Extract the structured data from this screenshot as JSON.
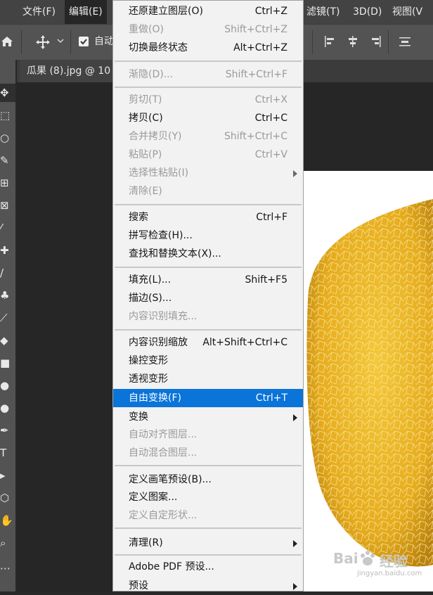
{
  "menubar": {
    "items": [
      {
        "label": "文件(F)"
      },
      {
        "label": "编辑(E)"
      },
      {
        "label": "滤镜(T)"
      },
      {
        "label": "3D(D)"
      },
      {
        "label": "视图(V"
      }
    ]
  },
  "options_bar": {
    "auto_select_label": "自动"
  },
  "tab": {
    "title": "瓜果 (8).jpg @ 10"
  },
  "edit_menu": {
    "items": [
      {
        "label": "还原建立图层(O)",
        "shortcut": "Ctrl+Z",
        "disabled": false
      },
      {
        "label": "重做(O)",
        "shortcut": "Shift+Ctrl+Z",
        "disabled": true
      },
      {
        "label": "切换最终状态",
        "shortcut": "Alt+Ctrl+Z",
        "disabled": false
      },
      {
        "label": "渐隐(D)...",
        "shortcut": "Shift+Ctrl+F",
        "disabled": true
      },
      {
        "label": "剪切(T)",
        "shortcut": "Ctrl+X",
        "disabled": true
      },
      {
        "label": "拷贝(C)",
        "shortcut": "Ctrl+C",
        "disabled": false
      },
      {
        "label": "合并拷贝(Y)",
        "shortcut": "Shift+Ctrl+C",
        "disabled": true
      },
      {
        "label": "粘贴(P)",
        "shortcut": "Ctrl+V",
        "disabled": true
      },
      {
        "label": "选择性粘贴(I)",
        "shortcut": "",
        "disabled": true,
        "submenu": true
      },
      {
        "label": "清除(E)",
        "shortcut": "",
        "disabled": true
      },
      {
        "label": "搜索",
        "shortcut": "Ctrl+F",
        "disabled": false
      },
      {
        "label": "拼写检查(H)...",
        "shortcut": "",
        "disabled": false
      },
      {
        "label": "查找和替换文本(X)...",
        "shortcut": "",
        "disabled": false
      },
      {
        "label": "填充(L)...",
        "shortcut": "Shift+F5",
        "disabled": false
      },
      {
        "label": "描边(S)...",
        "shortcut": "",
        "disabled": false
      },
      {
        "label": "内容识别填充...",
        "shortcut": "",
        "disabled": true
      },
      {
        "label": "内容识别缩放",
        "shortcut": "Alt+Shift+Ctrl+C",
        "disabled": false
      },
      {
        "label": "操控变形",
        "shortcut": "",
        "disabled": false
      },
      {
        "label": "透视变形",
        "shortcut": "",
        "disabled": false
      },
      {
        "label": "自由变换(F)",
        "shortcut": "Ctrl+T",
        "disabled": false,
        "highlighted": true
      },
      {
        "label": "变换",
        "shortcut": "",
        "disabled": false,
        "submenu": true
      },
      {
        "label": "自动对齐图层...",
        "shortcut": "",
        "disabled": true
      },
      {
        "label": "自动混合图层...",
        "shortcut": "",
        "disabled": true
      },
      {
        "label": "定义画笔预设(B)...",
        "shortcut": "",
        "disabled": false
      },
      {
        "label": "定义图案...",
        "shortcut": "",
        "disabled": false
      },
      {
        "label": "定义自定形状...",
        "shortcut": "",
        "disabled": true
      },
      {
        "label": "清理(R)",
        "shortcut": "",
        "disabled": false,
        "submenu": true
      },
      {
        "label": "Adobe PDF 预设...",
        "shortcut": "",
        "disabled": false
      },
      {
        "label": "预设",
        "shortcut": "",
        "disabled": false,
        "submenu": true
      }
    ]
  },
  "watermark": {
    "brand": "Bai",
    "suffix": "经验",
    "url": "jingyan.baidu.com"
  },
  "colors": {
    "highlight": "#0a74d9",
    "menu_bg": "#f2f2f2",
    "melon": "#e8b020"
  }
}
